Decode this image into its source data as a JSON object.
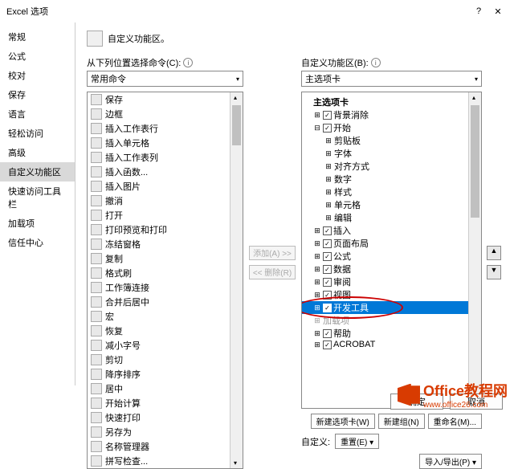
{
  "title": "Excel 选项",
  "sidebar": [
    "常规",
    "公式",
    "校对",
    "保存",
    "语言",
    "轻松访问",
    "高级",
    "自定义功能区",
    "快速访问工具栏",
    "加载项",
    "信任中心"
  ],
  "sidebar_selected": 7,
  "header": "自定义功能区。",
  "left_label": "从下列位置选择命令(C):",
  "left_combo": "常用命令",
  "right_label": "自定义功能区(B):",
  "right_combo": "主选项卡",
  "commands": [
    "保存",
    "边框",
    "插入工作表行",
    "插入单元格",
    "插入工作表列",
    "插入函数...",
    "插入图片",
    "撤消",
    "打开",
    "打印预览和打印",
    "冻结窗格",
    "复制",
    "格式刷",
    "工作簿连接",
    "合并后居中",
    "宏",
    "恢复",
    "减小字号",
    "剪切",
    "降序排序",
    "居中",
    "开始计算",
    "快速打印",
    "另存为",
    "名称管理器",
    "拼写检查..."
  ],
  "tree": [
    {
      "d": 1,
      "exp": "",
      "chk": "",
      "label": "主选项卡",
      "bold": true
    },
    {
      "d": 2,
      "exp": "⊞",
      "chk": "✓",
      "label": "背景消除"
    },
    {
      "d": 2,
      "exp": "⊟",
      "chk": "✓",
      "label": "开始"
    },
    {
      "d": 3,
      "exp": "⊞",
      "chk": "",
      "label": "剪贴板"
    },
    {
      "d": 3,
      "exp": "⊞",
      "chk": "",
      "label": "字体"
    },
    {
      "d": 3,
      "exp": "⊞",
      "chk": "",
      "label": "对齐方式"
    },
    {
      "d": 3,
      "exp": "⊞",
      "chk": "",
      "label": "数字"
    },
    {
      "d": 3,
      "exp": "⊞",
      "chk": "",
      "label": "样式"
    },
    {
      "d": 3,
      "exp": "⊞",
      "chk": "",
      "label": "单元格"
    },
    {
      "d": 3,
      "exp": "⊞",
      "chk": "",
      "label": "编辑"
    },
    {
      "d": 2,
      "exp": "⊞",
      "chk": "✓",
      "label": "插入"
    },
    {
      "d": 2,
      "exp": "⊞",
      "chk": "✓",
      "label": "页面布局"
    },
    {
      "d": 2,
      "exp": "⊞",
      "chk": "✓",
      "label": "公式"
    },
    {
      "d": 2,
      "exp": "⊞",
      "chk": "✓",
      "label": "数据"
    },
    {
      "d": 2,
      "exp": "⊞",
      "chk": "✓",
      "label": "审阅"
    },
    {
      "d": 2,
      "exp": "⊞",
      "chk": "✓",
      "label": "视图"
    },
    {
      "d": 2,
      "exp": "⊞",
      "chk": "✓",
      "label": "开发工具",
      "selected": true
    },
    {
      "d": 2,
      "exp": "⊞",
      "chk": "",
      "label": "加载项",
      "disabled": true
    },
    {
      "d": 2,
      "exp": "⊞",
      "chk": "✓",
      "label": "帮助"
    },
    {
      "d": 2,
      "exp": "⊞",
      "chk": "✓",
      "label": "ACROBAT"
    }
  ],
  "mid": {
    "add": "添加(A) >>",
    "remove": "<< 删除(R)"
  },
  "below": {
    "newtab": "新建选项卡(W)",
    "newgroup": "新建组(N)",
    "rename": "重命名(M)..."
  },
  "cust": {
    "label": "自定义:",
    "reset": "重置(E) ▾",
    "impexp": "导入/导出(P) ▾"
  },
  "footer": {
    "ok": "确定",
    "cancel": "取消"
  },
  "wm": {
    "t1": "Office教程网",
    "t2": "www.office26.com"
  }
}
